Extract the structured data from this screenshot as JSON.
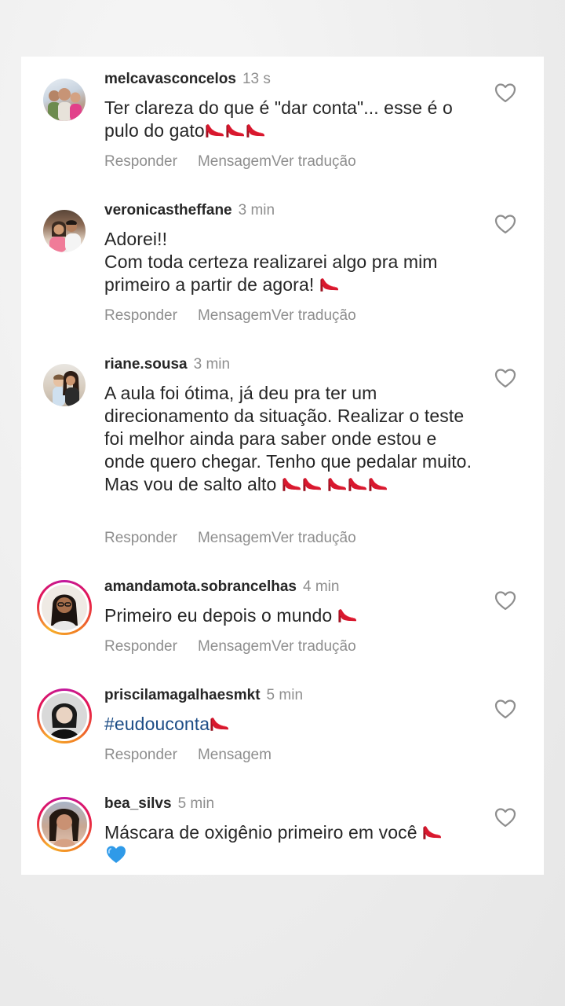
{
  "comments": [
    {
      "username": "melcavasconcelos",
      "time": "13 s",
      "text": "Ter clareza do que é \"dar conta\"... esse é o pulo do gato👠👠👠",
      "reply": "Responder",
      "message": "Mensagem",
      "translate": "Ver tradução"
    },
    {
      "username": "veronicastheffane",
      "time": "3 min",
      "text_lines": [
        "Adorei!!",
        "Com toda certeza realizarei algo pra mim",
        "primeiro a partir de agora! 👠"
      ],
      "reply": "Responder",
      "message": "Mensagem",
      "translate": "Ver tradução"
    },
    {
      "username": "riane.sousa",
      "time": "3 min",
      "text": "A aula foi ótima, já deu pra ter um direcionamento da situação. Realizar o teste foi melhor ainda para saber onde estou e onde quero chegar. Tenho que pedalar muito. Mas vou de salto alto 👠👠👠👠👠",
      "reply": "Responder",
      "message": "Mensagem",
      "translate": "Ver tradução"
    },
    {
      "username": "amandamota.sobrancelhas",
      "time": "4 min",
      "text": "Primeiro eu depois o mundo 👠",
      "reply": "Responder",
      "message": "Mensagem",
      "translate": "Ver tradução"
    },
    {
      "username": "priscilamagalhaesmkt",
      "time": "5 min",
      "text": "#eudouconta👠",
      "reply": "Responder",
      "message": "Mensagem"
    },
    {
      "username": "bea_silvs",
      "time": "5 min",
      "text": "Máscara de oxigênio primeiro em você 👠💙"
    }
  ],
  "colors": {
    "username": "#262626",
    "meta": "#8e8e8e",
    "hashtag": "#1d4d86",
    "story_ring": "#e6154d"
  },
  "icons": {
    "like": "heart-outline-icon",
    "emoji": "high-heel-shoe",
    "heart_emoji": "blue-heart"
  }
}
